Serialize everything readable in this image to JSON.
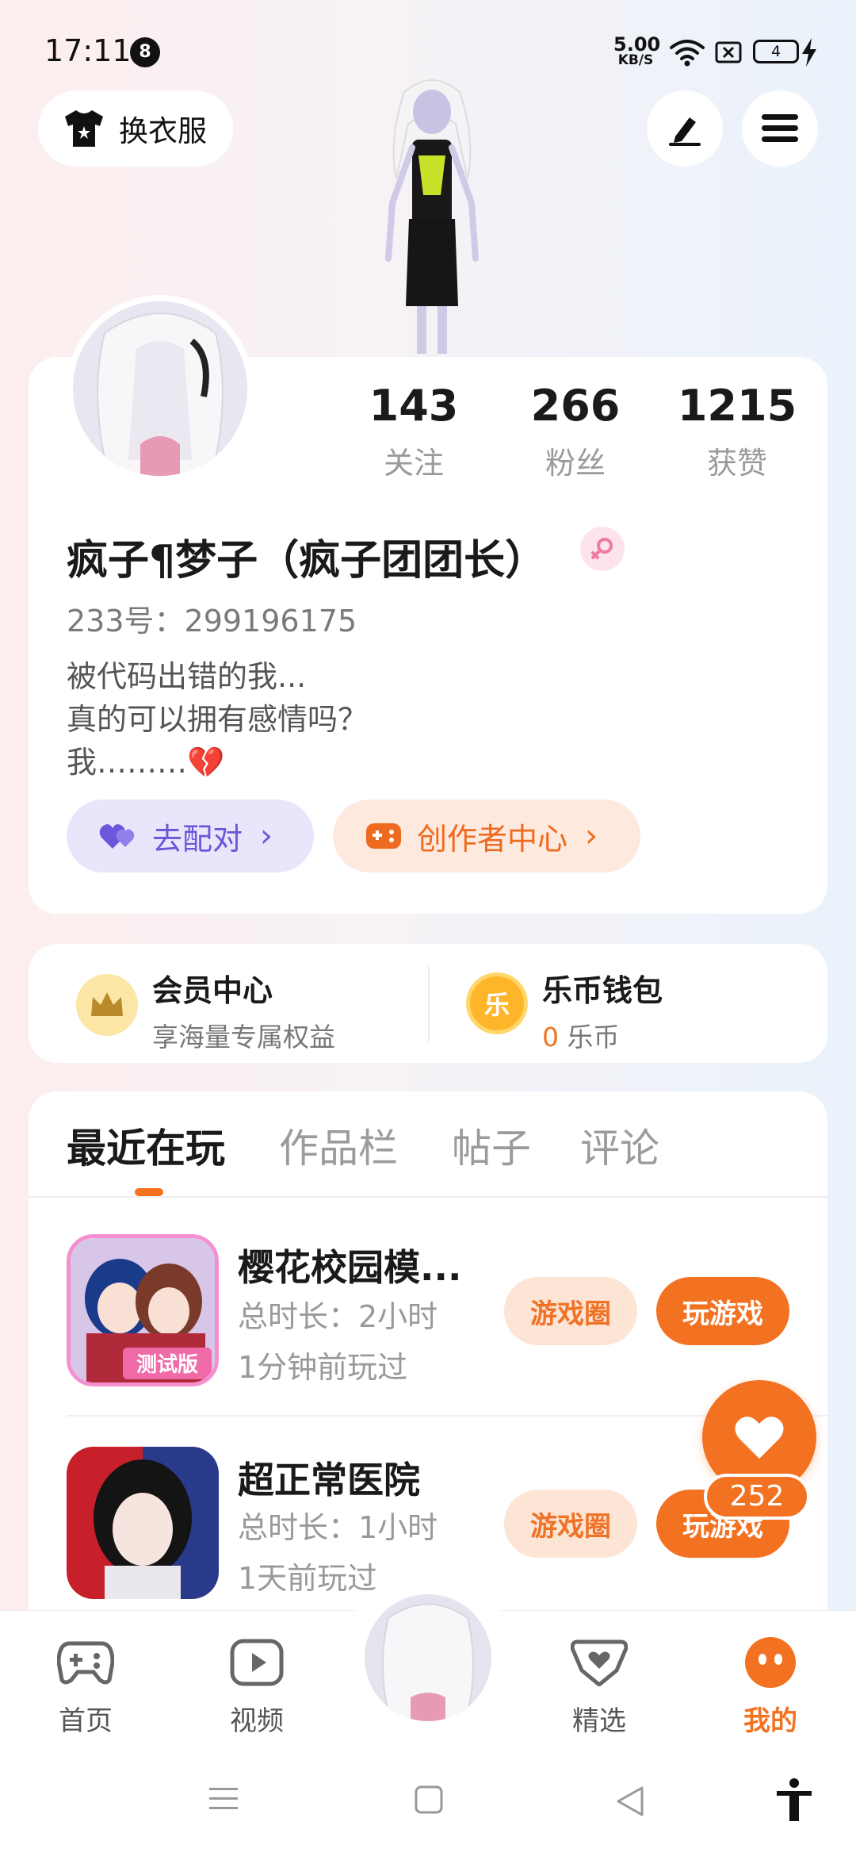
{
  "status_bar": {
    "time": "17:11",
    "notification_count": "8",
    "net_speed_value": "5.00",
    "net_speed_unit": "KB/S",
    "battery_level": "4"
  },
  "top": {
    "outfit_label": "换衣服"
  },
  "profile": {
    "stats": [
      {
        "value": "143",
        "label": "关注"
      },
      {
        "value": "266",
        "label": "粉丝"
      },
      {
        "value": "1215",
        "label": "获赞"
      }
    ],
    "username": "疯子¶梦子（疯子团团长）",
    "uid": "233号：299196175",
    "bio_lines": [
      "被代码出错的我...",
      "真的可以拥有感情吗？",
      "我………💔"
    ],
    "pair_label": "去配对",
    "creator_label": "创作者中心"
  },
  "member": {
    "vip_title": "会员中心",
    "vip_sub": "享海量专属权益",
    "wallet_title": "乐币钱包",
    "wallet_amount": "0",
    "wallet_unit": "乐币",
    "coin_char": "乐"
  },
  "tabs": [
    "最近在玩",
    "作品栏",
    "帖子",
    "评论"
  ],
  "games": [
    {
      "name": "樱花校园模...",
      "duration": "总时长：2小时",
      "last_played": "1分钟前玩过",
      "circle_label": "游戏圈",
      "play_label": "玩游戏",
      "badge": "测试版"
    },
    {
      "name": "超正常医院",
      "duration": "总时长：1小时",
      "last_played": "1天前玩过",
      "circle_label": "游戏圈",
      "play_label": "玩游戏"
    }
  ],
  "like_count": "252",
  "bottom_nav": [
    {
      "label": "首页",
      "icon": "gamepad-icon"
    },
    {
      "label": "视频",
      "icon": "play-icon"
    },
    {
      "label": "精选",
      "icon": "heart-chat-icon"
    },
    {
      "label": "我的",
      "icon": "face-icon"
    }
  ],
  "colors": {
    "accent": "#f37221",
    "pair_purple": "#6a57d9"
  }
}
